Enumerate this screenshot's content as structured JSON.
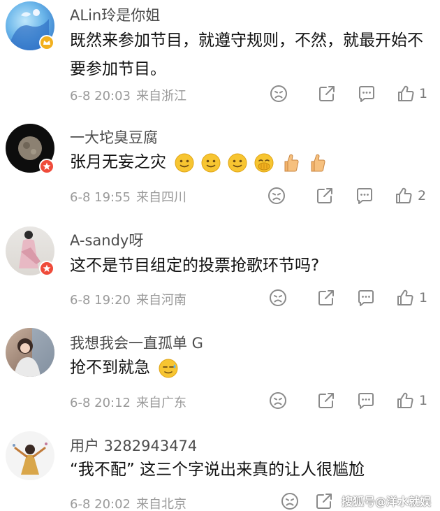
{
  "comments": [
    {
      "username": "ALin玲是你姐",
      "text": "既然来参加节目，就遵守规则，不然，就最开始不要参加节目。",
      "date": "6-8 20:03",
      "location": "来自浙江",
      "likes": "1",
      "badge_icon": "verified-crown-icon"
    },
    {
      "username": "一大坨臭豆腐",
      "text": "张月无妄之灾",
      "emojis": [
        "smile-emoji-icon",
        "smile-emoji-icon",
        "smile-emoji-icon",
        "cover-mouth-emoji-icon",
        "thumbs-up-emoji-icon",
        "thumbs-up-emoji-icon"
      ],
      "date": "6-8 19:55",
      "location": "来自四川",
      "likes": "2",
      "badge_icon": "vip-star-icon"
    },
    {
      "username": "A-sandy呀",
      "text": "这不是节目组定的投票抢歌环节吗?",
      "date": "6-8 19:20",
      "location": "来自河南",
      "likes": "1",
      "badge_icon": "vip-star-icon"
    },
    {
      "username": "我想我会一直孤单 G",
      "text": "抢不到就急",
      "emojis": [
        "sweat-smile-emoji-icon"
      ],
      "date": "6-8 20:12",
      "location": "来自广东",
      "likes": "1"
    },
    {
      "username": "用户 3282943474",
      "text": "“我不配” 这三个字说出来真的让人很尴尬",
      "date": "6-8 20:02",
      "location": "来自北京"
    }
  ],
  "watermark": "搜狐号@洋水就娱",
  "colors": {
    "meta_text": "#9a9a9a",
    "icon": "#8a8a8a",
    "badge_gold": "#f2b01e",
    "badge_red": "#ef4b3a"
  }
}
